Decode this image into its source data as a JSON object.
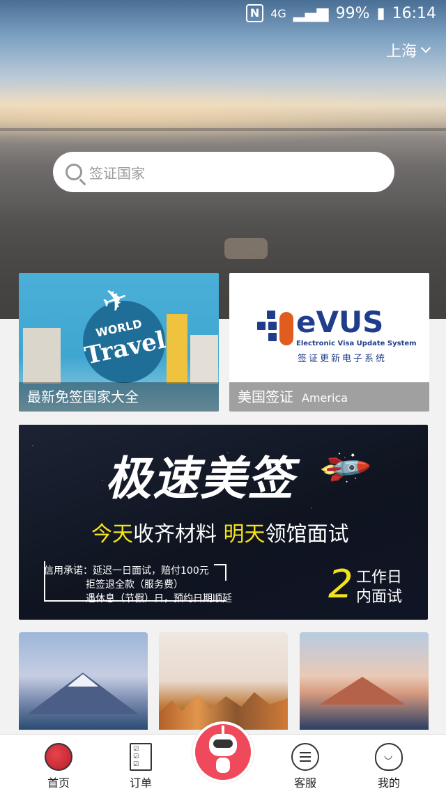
{
  "statusbar": {
    "network": "4G",
    "battery": "99%",
    "time": "16:14"
  },
  "header": {
    "city": "上海"
  },
  "search": {
    "placeholder": "签证国家"
  },
  "cards": [
    {
      "caption": "最新免签国家大全",
      "art_line1": "WORLD",
      "art_line2": "Travel"
    },
    {
      "caption": "美国签证",
      "caption_en": "America",
      "logo_text": "eVUS",
      "logo_sub_en": "Electronic Visa Update System",
      "logo_sub_cn": "签证更新电子系统"
    }
  ],
  "banner": {
    "headline": "极速美签",
    "sub_yellow_1": "今天",
    "sub_white_1": "收齐材料",
    "sub_yellow_2": "明天",
    "sub_white_2": "领馆面试",
    "promise_1": "信用承诺：延迟一日面试，赔付100元",
    "promise_2": "拒签退全款（服务费）",
    "promise_3": "遇休息（节假）日，预约日期顺延",
    "big_number": "2",
    "workday_1": "工作日",
    "workday_2": "内面试"
  },
  "tabbar": {
    "home": "首页",
    "orders": "订单",
    "service": "客服",
    "mine": "我的"
  }
}
